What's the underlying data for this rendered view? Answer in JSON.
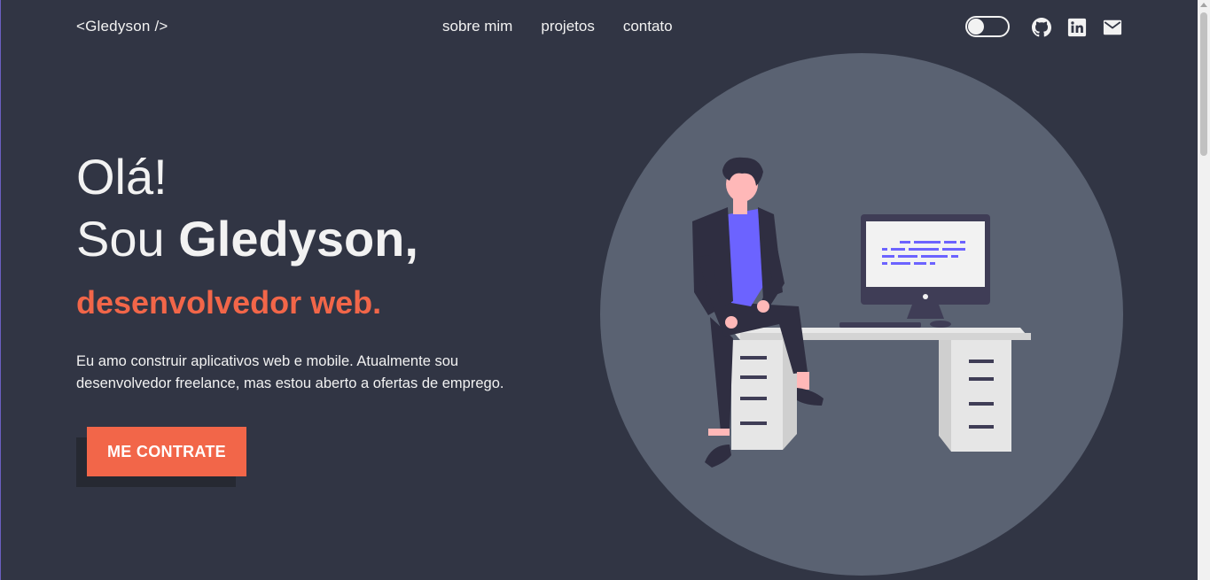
{
  "header": {
    "logo": "<Gledyson />",
    "nav": [
      {
        "label": "sobre mim"
      },
      {
        "label": "projetos"
      },
      {
        "label": "contato"
      }
    ],
    "theme_toggle": {
      "state": "off"
    },
    "social_icons": [
      "github-icon",
      "linkedin-icon",
      "mail-icon"
    ]
  },
  "hero": {
    "greeting": "Olá!",
    "intro_prefix": "Sou ",
    "name": "Gledyson,",
    "role": "desenvolvedor web.",
    "description": "Eu amo construir aplicativos web e mobile. Atualmente sou desenvolvedor freelance, mas estou aberto a ofertas de emprego.",
    "cta_label": "ME CONTRATE"
  },
  "colors": {
    "background": "#313544",
    "accent": "#f26649",
    "circle": "#5a6272",
    "text": "#f2f2f2",
    "code_purple": "#6c63ff"
  }
}
